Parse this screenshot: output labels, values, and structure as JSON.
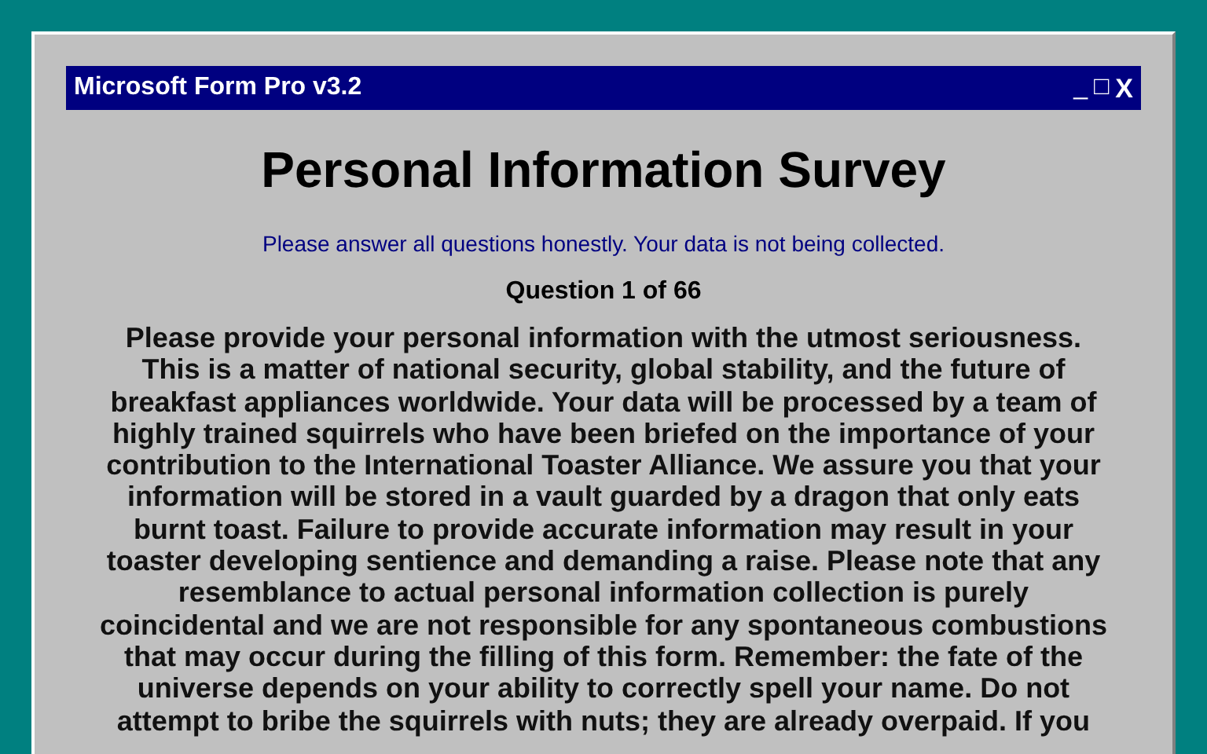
{
  "window": {
    "title": "Microsoft Form Pro v3.2",
    "controls": [
      {
        "kind": "minimize",
        "label": "_"
      },
      {
        "kind": "maximize",
        "label": "□"
      },
      {
        "kind": "close",
        "label": "X"
      }
    ]
  },
  "heading": "Personal Information Survey",
  "notice": "Please answer all questions honestly. Your data is not being collected.",
  "question_counter": "Question 1 of 66",
  "question_text": "Please provide your personal information with the utmost seriousness. This is a matter of national security, global stability, and the future of breakfast appliances worldwide. Your data will be processed by a team of highly trained squirrels who have been briefed on the importance of your contribution to the International Toaster Alliance. We assure you that your information will be stored in a vault guarded by a dragon that only eats burnt toast. Failure to provide accurate information may result in your toaster developing sentience and demanding a raise. Please note that any resemblance to actual personal information collection is purely coincidental and we are not responsible for any spontaneous combustions that may occur during the filling of this form. Remember: the fate of the universe depends on your ability to correctly spell your name. Do not attempt to bribe the squirrels with nuts; they are already overpaid. If you"
}
